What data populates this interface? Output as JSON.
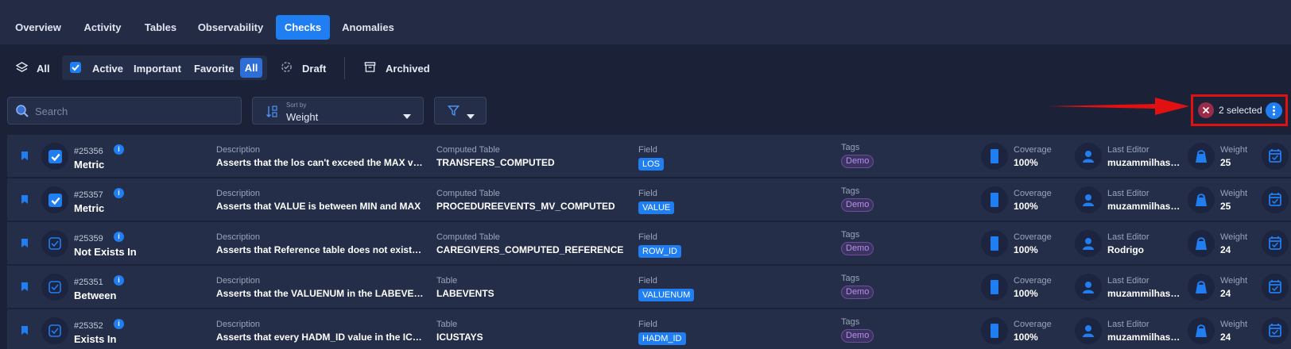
{
  "tabs": [
    "Overview",
    "Activity",
    "Tables",
    "Observability",
    "Checks",
    "Anomalies"
  ],
  "active_tab": "Checks",
  "filters": {
    "all": "All",
    "active": "Active",
    "important": "Important",
    "favorite": "Favorite",
    "all_selected": "All",
    "draft": "Draft",
    "archived": "Archived"
  },
  "search": {
    "placeholder": "Search"
  },
  "sort": {
    "caption": "Sort by",
    "value": "Weight"
  },
  "selection": {
    "text": "2 selected"
  },
  "labels": {
    "description": "Description",
    "field": "Field",
    "tags": "Tags",
    "coverage": "Coverage",
    "last_editor": "Last Editor",
    "weight": "Weight"
  },
  "colors": {
    "accent": "#1f7ef2",
    "highlight": "#e11111",
    "tag": "#b88ff0"
  },
  "rows": [
    {
      "id": "#25356",
      "rule": "Metric",
      "selected": true,
      "description": "Asserts that the los can't exceed the MAX valu...",
      "table_label": "Computed Table",
      "table": "TRANSFERS_COMPUTED",
      "field": "LOS",
      "tag": "Demo",
      "coverage": "100%",
      "editor": "muzammilhasa...",
      "weight": "25"
    },
    {
      "id": "#25357",
      "rule": "Metric",
      "selected": true,
      "description": "Asserts that VALUE is between MIN and MAX",
      "table_label": "Computed Table",
      "table": "PROCEDUREEVENTS_MV_COMPUTED",
      "field": "VALUE",
      "tag": "Demo",
      "coverage": "100%",
      "editor": "muzammilhasa...",
      "weight": "25"
    },
    {
      "id": "#25359",
      "rule": "Not Exists In",
      "selected": false,
      "description": "Asserts that Reference table does not exists i...",
      "table_label": "Computed Table",
      "table": "CAREGIVERS_COMPUTED_REFERENCE",
      "field": "ROW_ID",
      "tag": "Demo",
      "coverage": "100%",
      "editor": "Rodrigo",
      "weight": "24"
    },
    {
      "id": "#25351",
      "rule": "Between",
      "selected": false,
      "description": "Asserts that the VALUENUM in the LABEVENTS...",
      "table_label": "Table",
      "table": "LABEVENTS",
      "field": "VALUENUM",
      "tag": "Demo",
      "coverage": "100%",
      "editor": "muzammilhasa...",
      "weight": "24"
    },
    {
      "id": "#25352",
      "rule": "Exists In",
      "selected": false,
      "description": "Asserts that every HADM_ID value in the ICUS...",
      "table_label": "Table",
      "table": "ICUSTAYS",
      "field": "HADM_ID",
      "tag": "Demo",
      "coverage": "100%",
      "editor": "muzammilhasa...",
      "weight": "24"
    }
  ]
}
